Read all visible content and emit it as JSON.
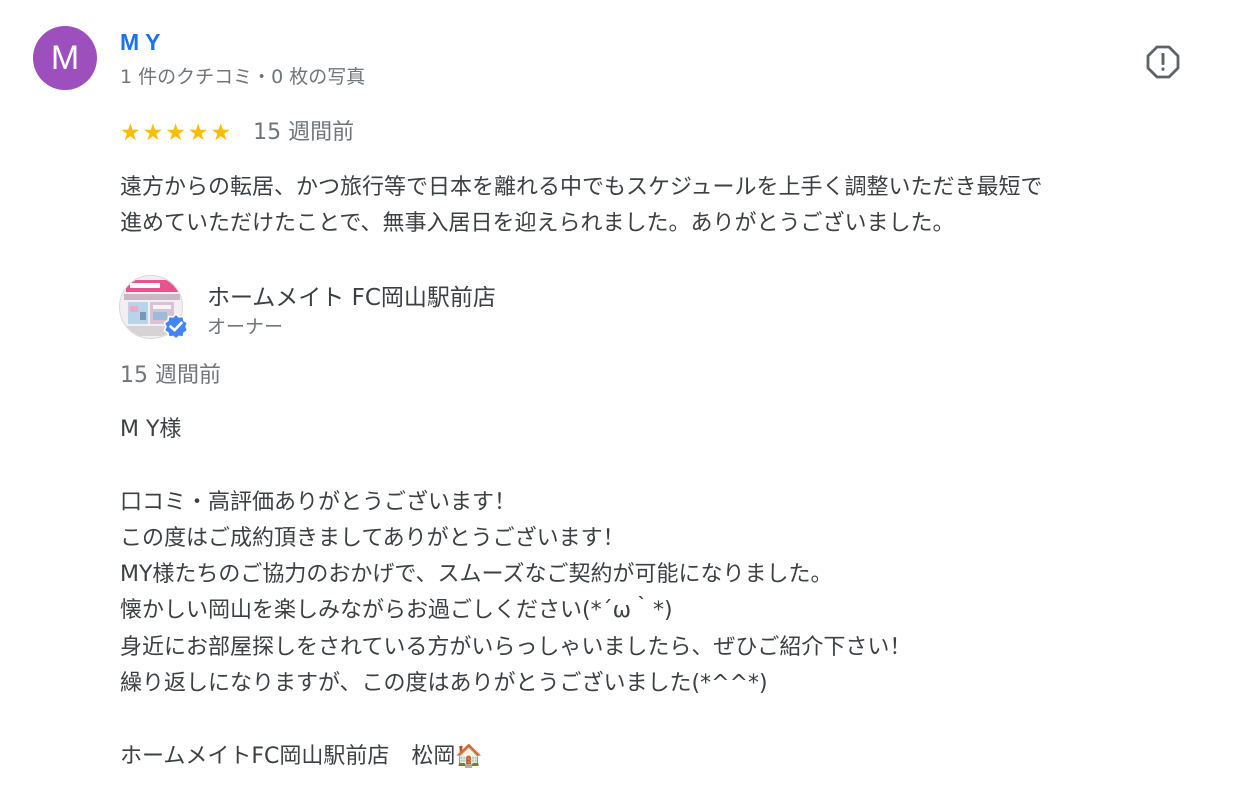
{
  "reviewer": {
    "avatar_letter": "M",
    "avatar_color": "#9c4fbd",
    "name": "M Y",
    "meta": "1 件のクチコミ・0 枚の写真"
  },
  "review": {
    "rating": 5,
    "stars": [
      "★",
      "★",
      "★",
      "★",
      "★"
    ],
    "time": "15 週間前",
    "text": "遠方からの転居、かつ旅行等で日本を離れる中でもスケジュールを上手く調整いただき最短で\n進めていただけたことで、無事入居日を迎えられました。ありがとうございました。"
  },
  "flag_icon": "report-flag-icon",
  "owner": {
    "name": "ホームメイト FC岡山駅前店",
    "role": "オーナー",
    "reply_time": "15 週間前",
    "reply_text": "M Y様\n\n口コミ・高評価ありがとうございます！\nこの度はご成約頂きましてありがとうございます！\nMY様たちのご協力のおかげで、スムーズなご契約が可能になりました。\n懐かしい岡山を楽しみながらお過ごしください(*´ω｀*)\n身近にお部屋探しをされている方がいらっしゃいましたら、ぜひご紹介下さい！\n繰り返しになりますが、この度はありがとうございました(*^^*)\n\nホームメイトFC岡山駅前店　松岡🏠"
  },
  "colors": {
    "link_blue": "#1a73e8",
    "star_yellow": "#fbbc04",
    "secondary_text": "#70757a",
    "body_text": "#3c4043",
    "verified_blue": "#4285f4"
  }
}
